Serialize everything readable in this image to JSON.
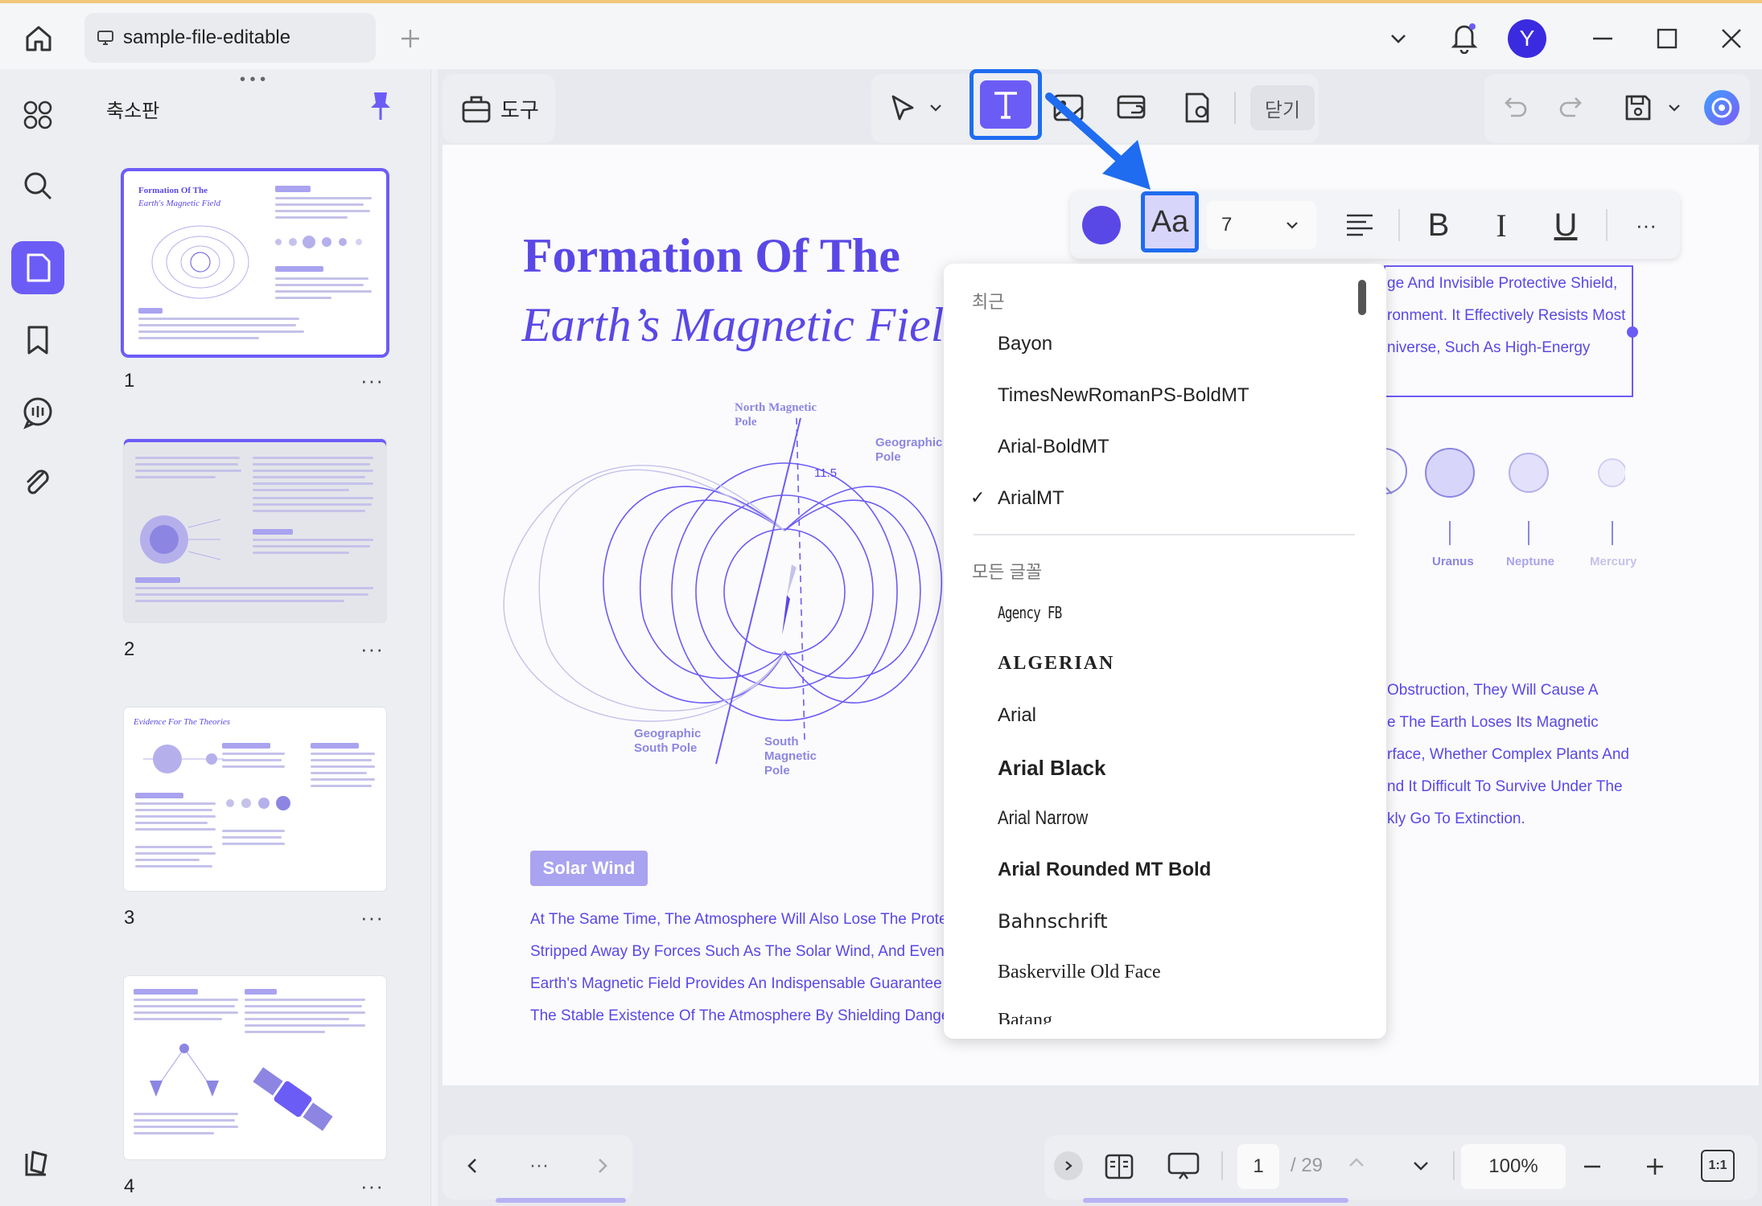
{
  "window": {
    "tab_title": "sample-file-editable",
    "avatar_letter": "Y"
  },
  "sidebar": {
    "title": "축소판",
    "thumbnails": [
      {
        "page": "1",
        "more": "···",
        "title": "Formation Of The",
        "subtitle": "Earth's Magnetic Field"
      },
      {
        "page": "2",
        "more": "···"
      },
      {
        "page": "3",
        "more": "···",
        "title": "Evidence For The Theories"
      },
      {
        "page": "4",
        "more": "···"
      }
    ]
  },
  "toolbar": {
    "tools_label": "도구",
    "close_label": "닫기"
  },
  "format_bar": {
    "font_button": "Aa",
    "font_size": "7",
    "bold": "B",
    "italic": "I",
    "underline": "U",
    "more": "···"
  },
  "font_menu": {
    "recent_header": "최근",
    "recent": [
      "Bayon",
      "TimesNewRomanPS-BoldMT",
      "Arial-BoldMT",
      "ArialMT"
    ],
    "selected": "ArialMT",
    "check": "✓",
    "all_header": "모든 글꼴",
    "all": [
      "Agency FB",
      "ALGERIAN",
      "Arial",
      "Arial Black",
      "Arial Narrow",
      "Arial Rounded MT Bold",
      "Bahnschrift",
      "Baskerville Old Face",
      "Batang"
    ]
  },
  "document": {
    "heading_line1": "Formation Of The",
    "heading_line2": "Earth’s Magnetic Field",
    "diagram_labels": {
      "north_magnetic": "North Magnetic Pole",
      "geo_north": "Geographic North Pole",
      "geo_south": "Geographic South Pole",
      "south_magnetic": "South Magnetic Pole",
      "angle": "11.5"
    },
    "solar_wind": "Solar Wind",
    "body_left": [
      "At The Same Time, The Atmosphere Will Also Lose The Prote",
      "Stripped Away By Forces Such As The Solar Wind, And Event",
      "Earth's Magnetic Field Provides An Indispensable Guarantee",
      "The Stable Existence Of The Atmosphere By Shielding Dange"
    ],
    "box_text": [
      "ge And Invisible Protective Shield,",
      "ronment. It Effectively Resists Most",
      "niverse, Such As High-Energy"
    ],
    "body_right": [
      "Obstruction, They Will Cause A",
      "e The Earth Loses Its Magnetic",
      "rface, Whether Complex Plants And",
      "nd It Difficult To Survive Under The",
      "kly Go To Extinction."
    ],
    "planets": [
      "Uranus",
      "Neptune",
      "Mercury"
    ]
  },
  "bottom": {
    "page_current": "1",
    "page_total": "/ 29",
    "zoom": "100%",
    "nav_more": "···",
    "fit": "1:1"
  },
  "colors": {
    "accent": "#6c5cf6",
    "highlight": "#1f6cf0",
    "doc_text": "#5a48e6"
  }
}
